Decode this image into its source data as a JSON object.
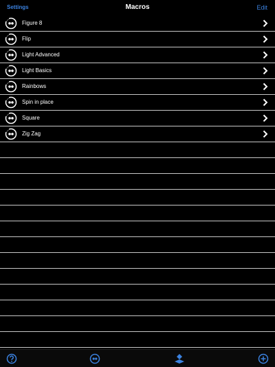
{
  "header": {
    "left_label": "Settings",
    "title": "Macros",
    "right_label": "Edit"
  },
  "list": {
    "items": [
      {
        "label": "Figure 8"
      },
      {
        "label": "Flip"
      },
      {
        "label": "Light Advanced"
      },
      {
        "label": "Light Basics"
      },
      {
        "label": "Rainbows"
      },
      {
        "label": "Spin in place"
      },
      {
        "label": "Square"
      },
      {
        "label": "Zig Zag"
      }
    ]
  },
  "tabbar": {
    "items": [
      {
        "icon": "help-icon"
      },
      {
        "icon": "sphero-icon"
      },
      {
        "icon": "drive-icon"
      },
      {
        "icon": "add-icon"
      }
    ]
  },
  "colors": {
    "background": "#000000",
    "accent": "#3b82e0",
    "divider": "#c8c8c8"
  }
}
